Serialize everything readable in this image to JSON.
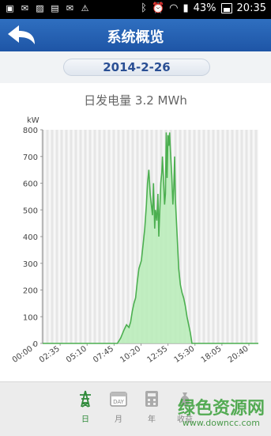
{
  "status_bar": {
    "battery": "43%",
    "time": "20:35"
  },
  "header": {
    "title": "系统概览"
  },
  "date": "2014-2-26",
  "chart_title": "日发电量 3.2 MWh",
  "chart_data": {
    "type": "area",
    "ylabel": "kW",
    "ylim": [
      0,
      800
    ],
    "yticks": [
      "0",
      "100",
      "200",
      "300",
      "400",
      "500",
      "600",
      "700",
      "800"
    ],
    "xticks": [
      "00:00",
      "02:35",
      "05:10",
      "07:45",
      "10:20",
      "12:55",
      "15:30",
      "18:05",
      "20:40"
    ],
    "x_minutes_range": [
      0,
      1300
    ],
    "series": [
      {
        "x": [
          0,
          450,
          470,
          490,
          505,
          520,
          530,
          540,
          550,
          560,
          570,
          580,
          595,
          605,
          615,
          625,
          632,
          640,
          648,
          655,
          662,
          668,
          675,
          680,
          688,
          695,
          700,
          705,
          712,
          718,
          722,
          728,
          735,
          740,
          745,
          750,
          755,
          760,
          765,
          770,
          778,
          785,
          790,
          795,
          800,
          810,
          820,
          830,
          840,
          850,
          860,
          870,
          880,
          890,
          900,
          920,
          1300
        ],
        "values": [
          0,
          0,
          20,
          50,
          70,
          60,
          80,
          120,
          150,
          170,
          230,
          280,
          310,
          370,
          430,
          520,
          600,
          650,
          560,
          520,
          480,
          600,
          430,
          500,
          460,
          560,
          400,
          480,
          600,
          640,
          700,
          620,
          520,
          560,
          790,
          620,
          780,
          740,
          790,
          720,
          630,
          520,
          580,
          700,
          540,
          410,
          280,
          220,
          190,
          170,
          140,
          100,
          70,
          40,
          0,
          0,
          0
        ]
      }
    ],
    "area_color": "#b7ecb7",
    "line_color": "#4caf50"
  },
  "tabs": [
    {
      "label": "日"
    },
    {
      "label": "月"
    },
    {
      "label": "年"
    },
    {
      "label": "收益"
    }
  ],
  "watermark": "绿色资源网",
  "watermark_url": "www.downcc.com"
}
